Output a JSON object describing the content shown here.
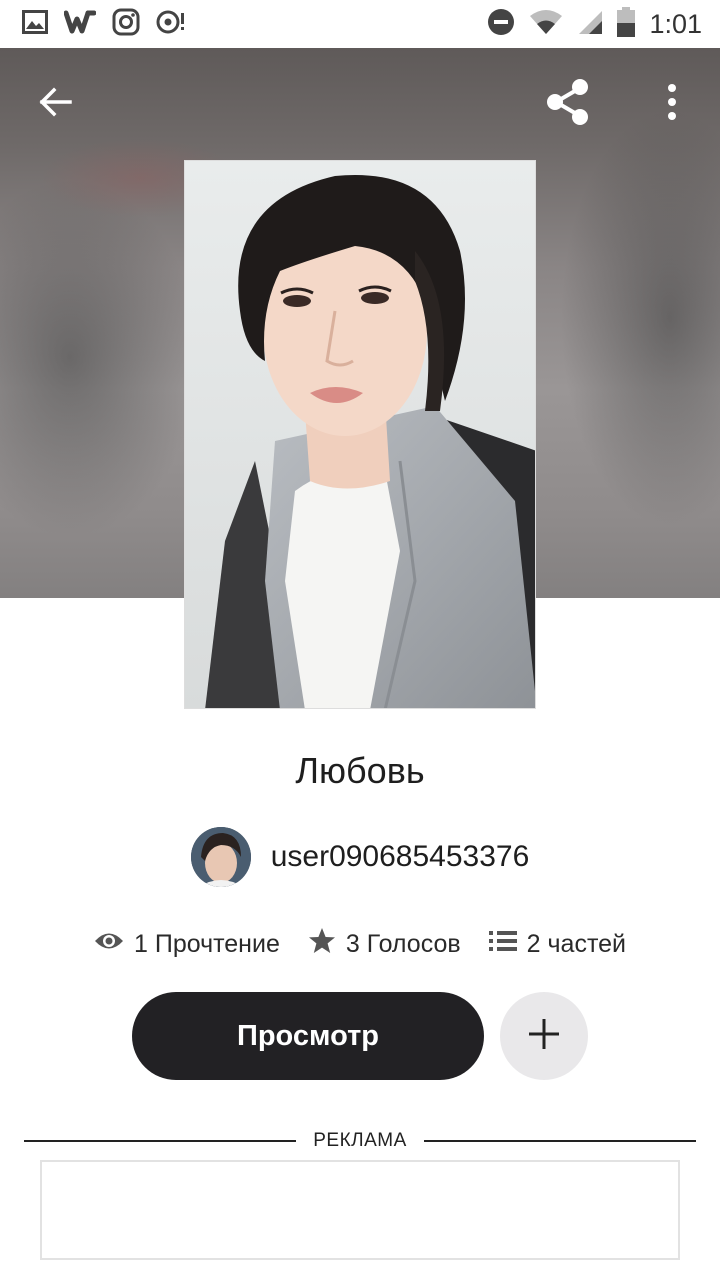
{
  "status_bar": {
    "time": "1:01",
    "left_icons": [
      "gallery-icon",
      "wattpad-icon",
      "instagram-icon",
      "podcast-icon"
    ],
    "right_icons": [
      "do-not-disturb-icon",
      "wifi-icon",
      "signal-icon",
      "battery-icon"
    ]
  },
  "toolbar": {
    "back_icon": "arrow-left-icon",
    "share_icon": "share-icon",
    "more_icon": "more-vertical-icon"
  },
  "story": {
    "title": "Любовь",
    "author": "user090685453376",
    "stats": {
      "reads": "1 Прочтение",
      "votes": "3 Голосов",
      "parts": "2 частей"
    }
  },
  "actions": {
    "read_label": "Просмотр",
    "add_icon": "plus-icon"
  },
  "ad": {
    "label": "РЕКЛАМА"
  },
  "colors": {
    "primary_button": "#222124",
    "secondary_button": "#e9e8ea",
    "text": "#1e1e1e"
  }
}
